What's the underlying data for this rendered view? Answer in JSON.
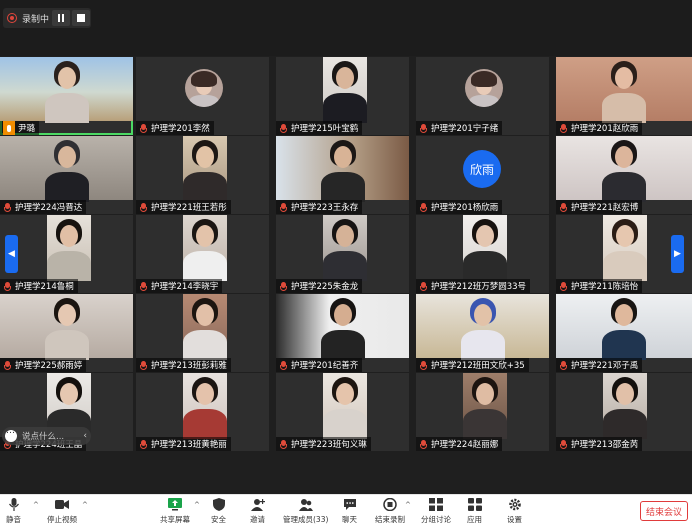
{
  "recording": {
    "label": "录制中"
  },
  "participants": [
    {
      "name": "尹璐",
      "row": 0,
      "col": 0,
      "mic": "on"
    },
    {
      "name": "护理学201李然",
      "row": 0,
      "col": 1,
      "avatar": "photo"
    },
    {
      "name": "护理学215叶宝鹤",
      "row": 0,
      "col": 2
    },
    {
      "name": "护理学201宁子绪",
      "row": 0,
      "col": 3,
      "avatar": "photo"
    },
    {
      "name": "护理学201赵欣雨",
      "row": 0,
      "col": 4
    },
    {
      "name": "护理学224冯晋达",
      "row": 1,
      "col": 0
    },
    {
      "name": "护理学221班王若彤",
      "row": 1,
      "col": 1
    },
    {
      "name": "护理学223王永存",
      "row": 1,
      "col": 2
    },
    {
      "name": "护理学201杨欣雨",
      "row": 1,
      "col": 3,
      "avatar": "text",
      "avatar_text": "欣雨"
    },
    {
      "name": "护理学221赵宏博",
      "row": 1,
      "col": 4
    },
    {
      "name": "护理学214鲁桐",
      "row": 2,
      "col": 0
    },
    {
      "name": "护理学214李晓宇",
      "row": 2,
      "col": 1
    },
    {
      "name": "护理学225朱金龙",
      "row": 2,
      "col": 2
    },
    {
      "name": "护理学212班万梦圆33号",
      "row": 2,
      "col": 3
    },
    {
      "name": "护理学211陈培怡",
      "row": 2,
      "col": 4
    },
    {
      "name": "护理学225郝雨婷",
      "row": 3,
      "col": 0
    },
    {
      "name": "护理学213班彭莉雅",
      "row": 3,
      "col": 1
    },
    {
      "name": "护理学201纪善齐",
      "row": 3,
      "col": 2
    },
    {
      "name": "护理学212班田文欣+35",
      "row": 3,
      "col": 3
    },
    {
      "name": "护理学221邓子禹",
      "row": 3,
      "col": 4
    },
    {
      "name": "护理学224班王晶",
      "row": 4,
      "col": 0
    },
    {
      "name": "护理学213班黄艳丽",
      "row": 4,
      "col": 1
    },
    {
      "name": "护理学223班句义琳",
      "row": 4,
      "col": 2
    },
    {
      "name": "护理学224赵丽娜",
      "row": 4,
      "col": 3
    },
    {
      "name": "护理学213邵金芮",
      "row": 4,
      "col": 4
    }
  ],
  "chat": {
    "placeholder": "说点什么..."
  },
  "toolbar": {
    "mute": "静音",
    "stop_video": "停止视频",
    "share": "共享屏幕",
    "security": "安全",
    "invite": "邀请",
    "members": "管理成员(33)",
    "chat": "聊天",
    "end_record": "结束录制",
    "breakout": "分组讨论",
    "apps": "应用",
    "settings": "设置",
    "end_meeting": "结束会议"
  },
  "colors": {
    "accent": "#1a6bf0",
    "danger": "#e03b3b",
    "speaking": "#4cd964"
  }
}
